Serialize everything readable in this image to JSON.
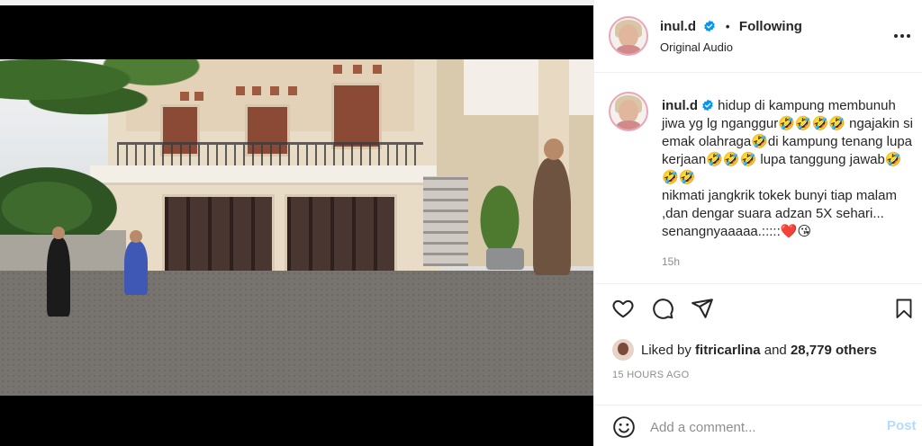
{
  "post": {
    "username": "inul.d",
    "follow_separator": "•",
    "follow_label": "Following",
    "audio_label": "Original Audio",
    "caption_text": "hidup di kampung membunuh jiwa yg lg nganggur🤣🤣🤣🤣 ngajakin si emak olahraga🤣di kampung tenang lupa kerjaan🤣🤣🤣 lupa tanggung jawab🤣🤣🤣\nnikmati jangkrik tokek bunyi tiap malam ,dan dengar suara adzan 5X sehari...\nsenangnyaaaaa.:::::❤️😘",
    "time_ago": "15h"
  },
  "actions": {
    "like_icon": "heart-icon",
    "comment_icon": "comment-icon",
    "share_icon": "share-icon",
    "save_icon": "bookmark-icon"
  },
  "likes": {
    "prefix": "Liked by ",
    "liker": "fitricarlina",
    "middle": " and ",
    "others": "28,779 others"
  },
  "posted_label": "15 HOURS AGO",
  "comment": {
    "placeholder": "Add a comment...",
    "post_label": "Post"
  },
  "colors": {
    "verified_blue": "#0095f6",
    "post_button_disabled": "#b3dbff",
    "avatar_ring": "#e9a6b8"
  },
  "media": {
    "type": "video",
    "muted": true
  }
}
